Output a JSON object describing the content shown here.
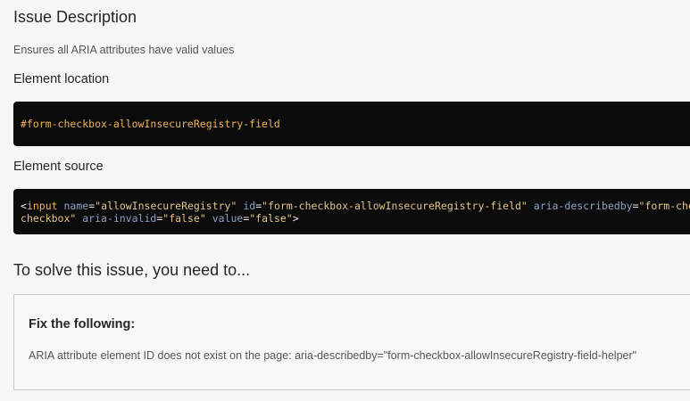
{
  "issue": {
    "heading": "Issue Description",
    "description": "Ensures all ARIA attributes have valid values"
  },
  "location": {
    "heading": "Element location",
    "selector": "#form-checkbox-allowInsecureRegistry-field"
  },
  "source": {
    "heading": "Element source",
    "line1": [
      {
        "t": "<",
        "c": "punct"
      },
      {
        "t": "input",
        "c": "tag"
      },
      {
        "t": " ",
        "c": "punct"
      },
      {
        "t": "name",
        "c": "attr"
      },
      {
        "t": "=",
        "c": "punct"
      },
      {
        "t": "\"allowInsecureRegistry\"",
        "c": "str"
      },
      {
        "t": " ",
        "c": "punct"
      },
      {
        "t": "id",
        "c": "attr"
      },
      {
        "t": "=",
        "c": "punct"
      },
      {
        "t": "\"form-checkbox-allowInsecureRegistry-field\"",
        "c": "str"
      },
      {
        "t": " ",
        "c": "punct"
      },
      {
        "t": "aria-describedby",
        "c": "attr"
      },
      {
        "t": "=",
        "c": "punct"
      },
      {
        "t": "\"form-checkbox-allowInsecureRegistry-field-helper\"",
        "c": "str"
      }
    ],
    "line2": [
      {
        "t": "checkbox\"",
        "c": "str"
      },
      {
        "t": " ",
        "c": "punct"
      },
      {
        "t": "aria-invalid",
        "c": "attr"
      },
      {
        "t": "=",
        "c": "punct"
      },
      {
        "t": "\"false\"",
        "c": "str"
      },
      {
        "t": " ",
        "c": "punct"
      },
      {
        "t": "value",
        "c": "attr"
      },
      {
        "t": "=",
        "c": "punct"
      },
      {
        "t": "\"false\"",
        "c": "str"
      },
      {
        "t": ">",
        "c": "punct"
      }
    ]
  },
  "solve": {
    "heading": "To solve this issue, you need to...",
    "fix_title": "Fix the following:",
    "fix_message": "ARIA attribute element ID does not exist on the page: aria-describedby=\"form-checkbox-allowInsecureRegistry-field-helper\""
  },
  "colors": {
    "code_bg": "#0b0b0b",
    "code_tag": "#f0b35a",
    "code_attr": "#8aa1c7",
    "code_string": "#e6c58a"
  }
}
